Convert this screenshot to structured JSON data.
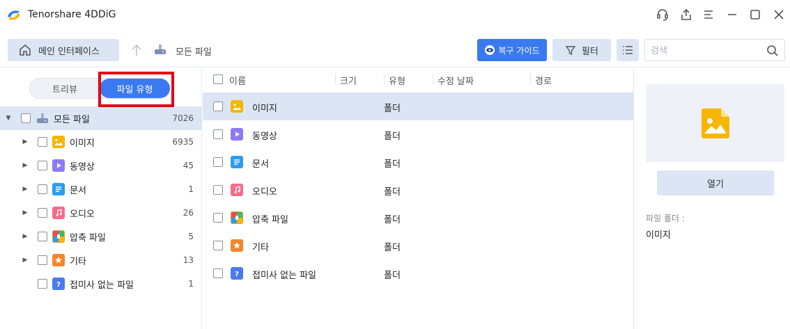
{
  "app": {
    "title": "Tenorshare 4DDiG"
  },
  "toolbar": {
    "home_label": "메인 인터페이스",
    "breadcrumb": "모든 파일",
    "guide_label": "복구 가이드",
    "filter_label": "필터",
    "search_placeholder": "검색"
  },
  "sidebar": {
    "tab_tree": "트리뷰",
    "tab_type": "파일 유형",
    "root": {
      "label": "모든 파일",
      "count": "7026"
    },
    "items": [
      {
        "label": "이미지",
        "count": "6935",
        "icon": "image-icon",
        "color": "#f7b500",
        "expandable": true
      },
      {
        "label": "동영상",
        "count": "45",
        "icon": "video-icon",
        "color": "#8b7cf6",
        "expandable": true
      },
      {
        "label": "문서",
        "count": "1",
        "icon": "document-icon",
        "color": "#2d9cf0",
        "expandable": true
      },
      {
        "label": "오디오",
        "count": "26",
        "icon": "audio-icon",
        "color": "#f56c8a",
        "expandable": true
      },
      {
        "label": "압축 파일",
        "count": "5",
        "icon": "archive-icon",
        "color": "#f0a020",
        "expandable": true
      },
      {
        "label": "기타",
        "count": "13",
        "icon": "other-icon",
        "color": "#f5862e",
        "expandable": true
      },
      {
        "label": "접미사 없는 파일",
        "count": "1",
        "icon": "unknown-file-icon",
        "color": "#4a7cf0",
        "expandable": false
      }
    ]
  },
  "list": {
    "columns": {
      "name": "이름",
      "size": "크기",
      "type": "유형",
      "modified": "수정 날짜",
      "path": "경로"
    },
    "rows": [
      {
        "name": "이미지",
        "type": "폴더"
      },
      {
        "name": "동영상",
        "type": "폴더"
      },
      {
        "name": "문서",
        "type": "폴더"
      },
      {
        "name": "오디오",
        "type": "폴더"
      },
      {
        "name": "압축 파일",
        "type": "폴더"
      },
      {
        "name": "기타",
        "type": "폴더"
      },
      {
        "name": "접미사 없는 파일",
        "type": "폴더"
      }
    ]
  },
  "preview": {
    "open_label": "열기",
    "folder_label": "파일 폴더 :",
    "folder_value": "이미지"
  },
  "colors": {
    "accent": "#3a79f0",
    "selected_bg": "#dce5f4",
    "highlight": "#e60012"
  }
}
